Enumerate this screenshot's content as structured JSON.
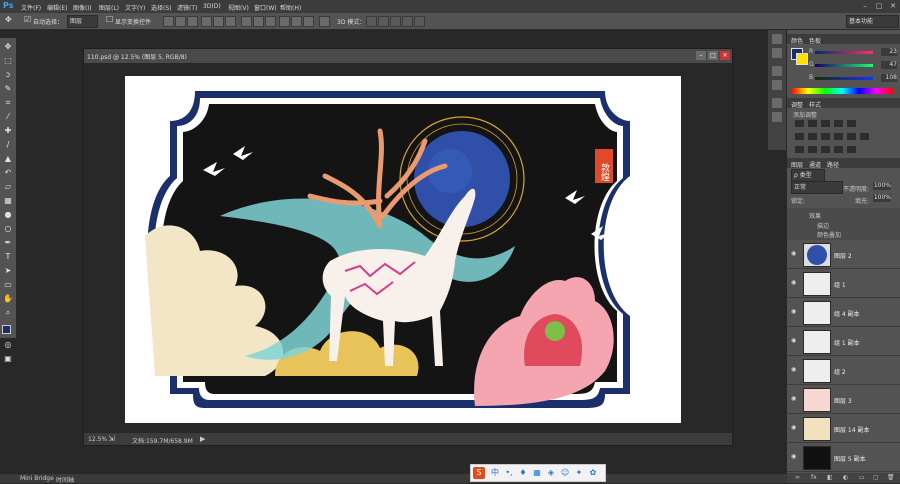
{
  "app": {
    "logo": "Ps"
  },
  "menu": [
    "文件(F)",
    "编辑(E)",
    "图像(I)",
    "图层(L)",
    "文字(Y)",
    "选择(S)",
    "滤镜(T)",
    "3D(D)",
    "视图(V)",
    "窗口(W)",
    "帮助(H)"
  ],
  "options": {
    "auto_select_label": "自动选择：",
    "auto_select_value": "图层",
    "show_transform_label": "显示变换控件",
    "mode_3d_label": "3D 模式：",
    "workspace": "基本功能"
  },
  "document": {
    "title": "110.psd @ 12.5% (图层 5, RGB/8)",
    "zoom": "12.5%",
    "doc_size": "文档:159.7M/658.9M",
    "artwork_text": "敦煌"
  },
  "color_panel": {
    "tabs": [
      "颜色",
      "色板"
    ],
    "r_label": "R",
    "g_label": "G",
    "b_label": "B",
    "r_value": "23",
    "g_value": "47",
    "b_value": "108",
    "fg_color": "#172f6c",
    "bg_color": "#ffdf00"
  },
  "adjust_panel": {
    "tabs": [
      "调整",
      "样式"
    ],
    "add_label": "添加调整"
  },
  "layers_panel": {
    "tabs": [
      "图层",
      "通道",
      "路径"
    ],
    "filter": "ρ 类型",
    "blend": "正常",
    "opacity_label": "不透明度:",
    "opacity_value": "100%",
    "lock_label": "锁定:",
    "fill_label": "填充:",
    "fill_value": "100%",
    "effects": {
      "title": "效果",
      "items": [
        "描边",
        "颜色叠加"
      ]
    },
    "layers": [
      "图层 2",
      "组 1",
      "组 4 副本",
      "组 1 副本",
      "组 2",
      "图层 3",
      "图层 14 副本",
      "图层 5 副本"
    ]
  },
  "bottom": {
    "tabs": [
      "Mini Bridge",
      "时间轴"
    ]
  },
  "ime": {
    "logo": "S",
    "lang": "中"
  }
}
